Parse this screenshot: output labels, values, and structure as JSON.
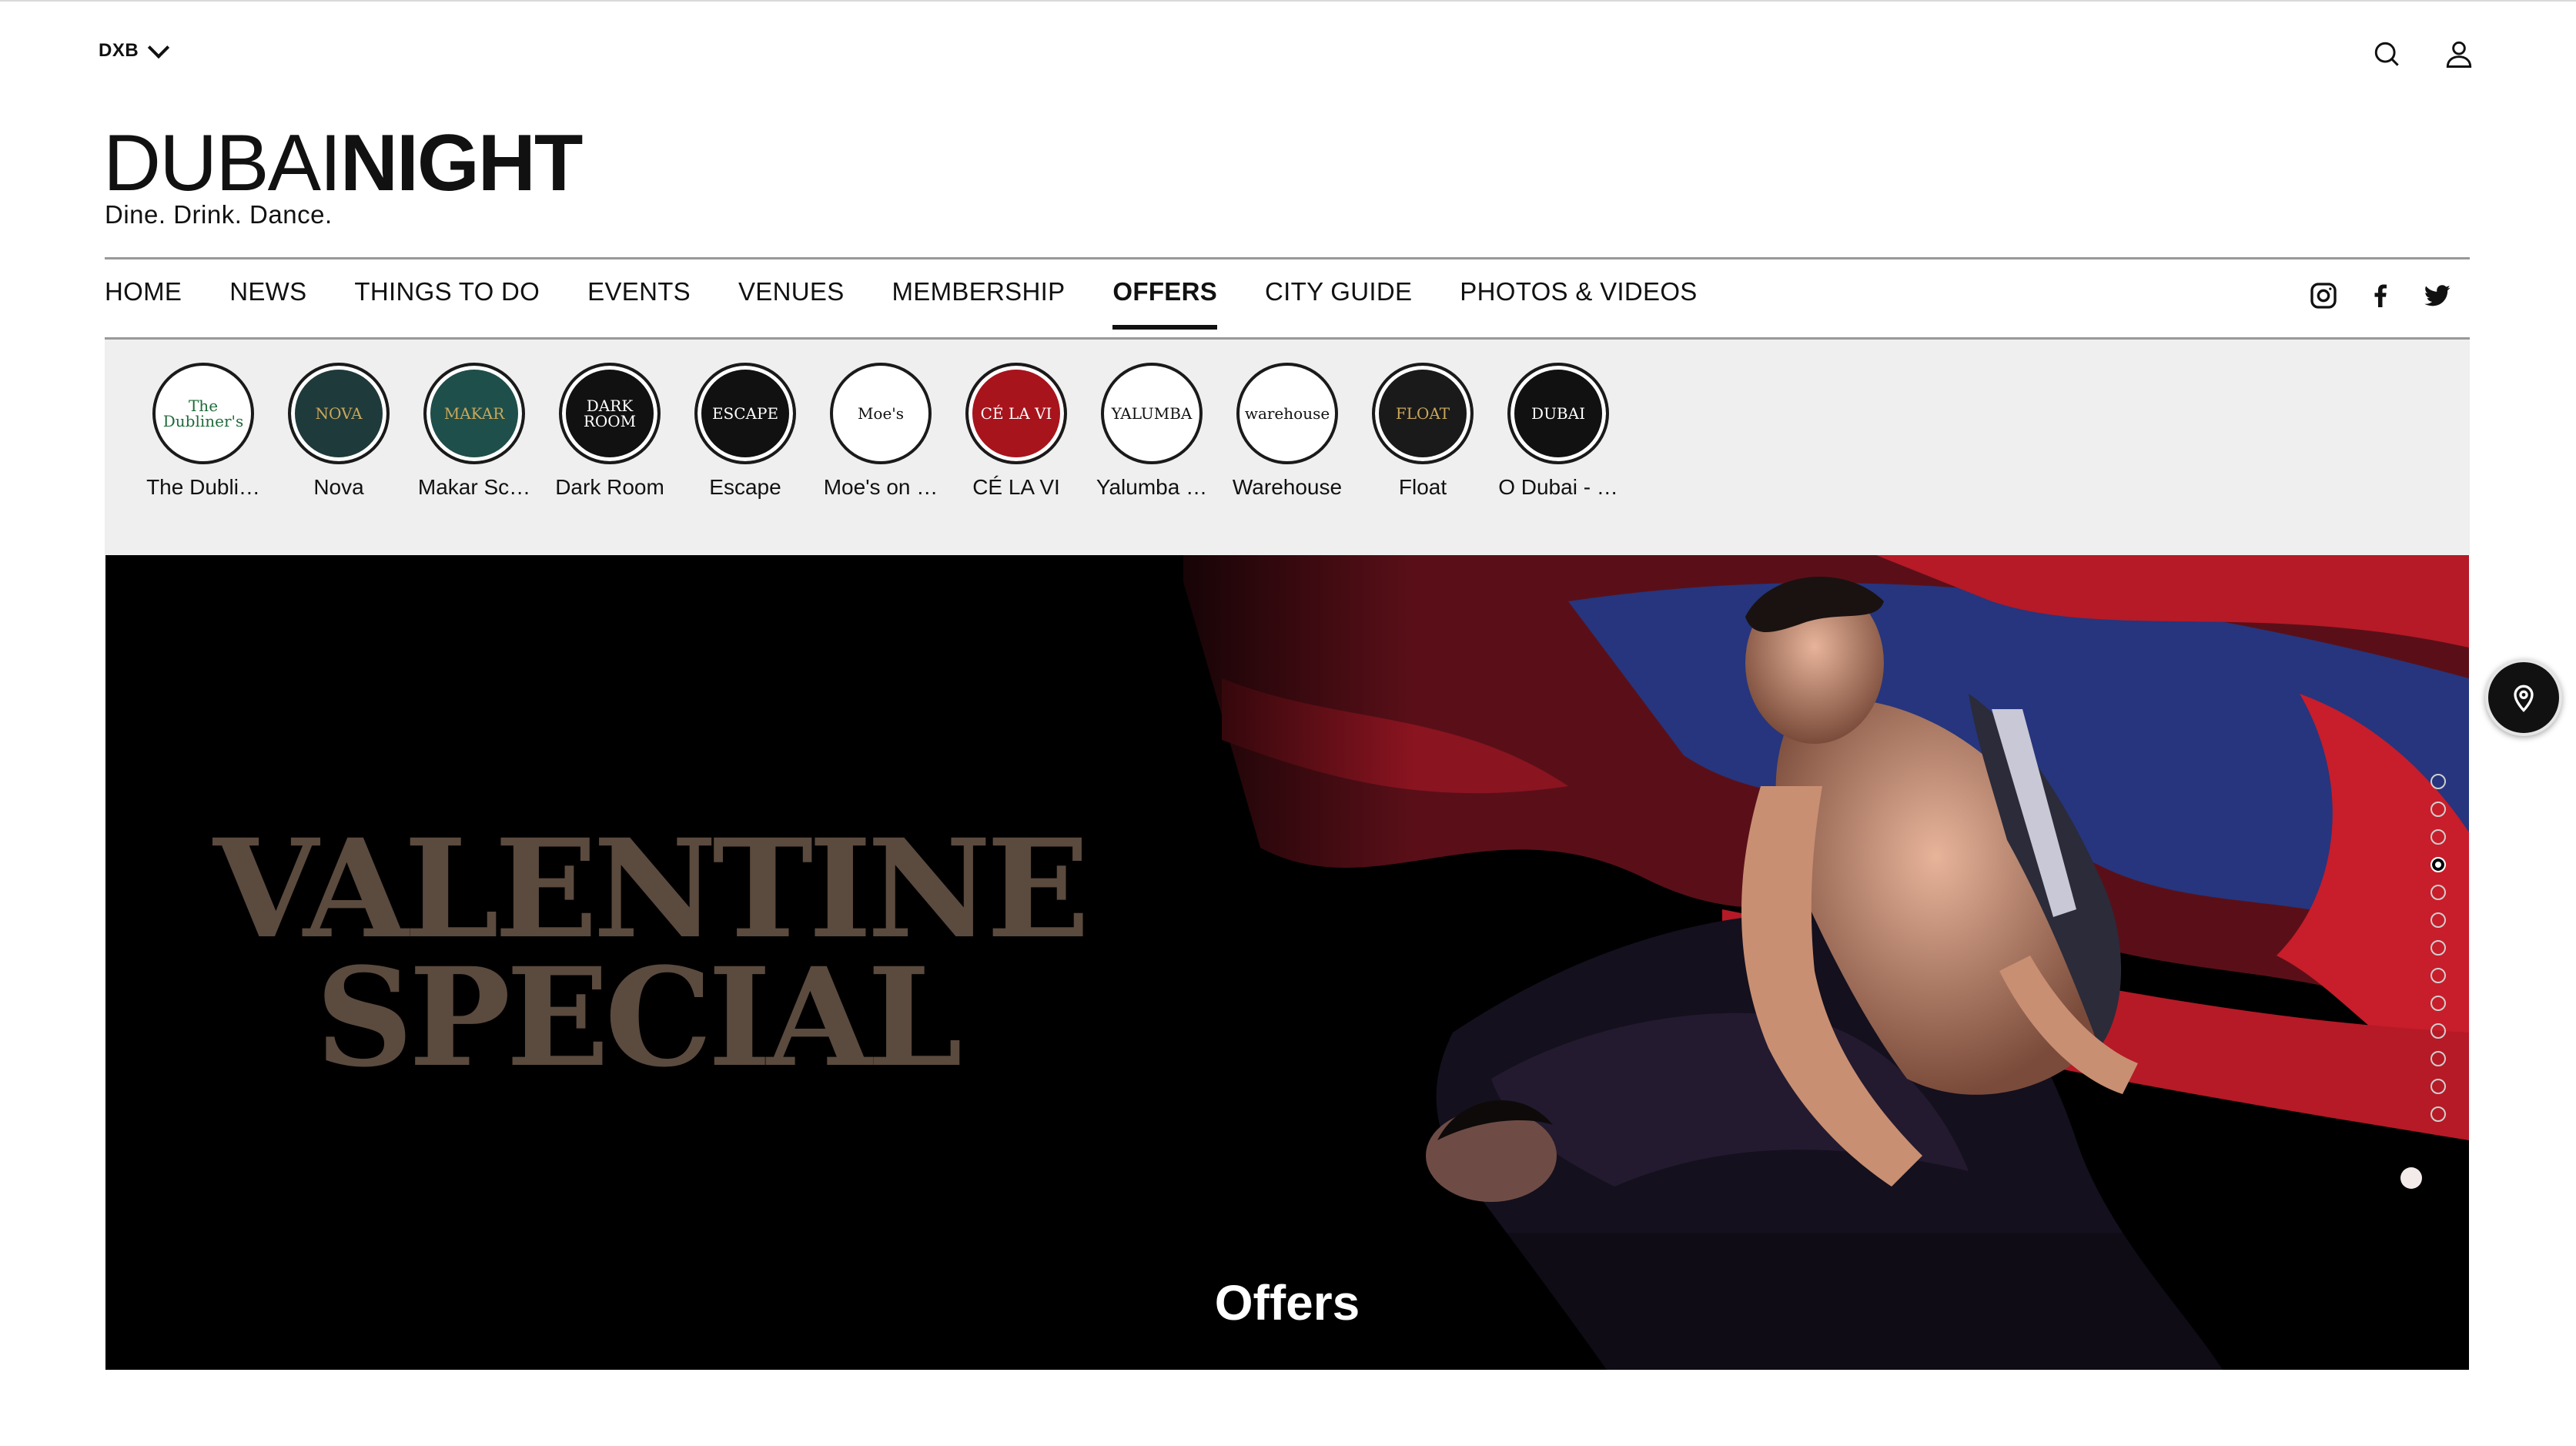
{
  "header": {
    "city": "DXB",
    "logo_light": "DUBAI",
    "logo_bold": "NIGHT",
    "tagline": "Dine. Drink. Dance."
  },
  "nav": {
    "items": [
      {
        "label": "HOME"
      },
      {
        "label": "NEWS"
      },
      {
        "label": "THINGS TO DO"
      },
      {
        "label": "EVENTS"
      },
      {
        "label": "VENUES"
      },
      {
        "label": "MEMBERSHIP"
      },
      {
        "label": "OFFERS",
        "active": true
      },
      {
        "label": "CITY GUIDE"
      },
      {
        "label": "PHOTOS & VIDEOS"
      }
    ],
    "social": [
      "instagram-icon",
      "facebook-icon",
      "twitter-icon"
    ]
  },
  "venues": [
    {
      "name": "The Dubli…",
      "logo": "The Dubliner's",
      "bg": "#ffffff",
      "fg": "#1f6b3a"
    },
    {
      "name": "Nova",
      "logo": "NOVA",
      "bg": "#1f3a3a",
      "fg": "#c9a65a"
    },
    {
      "name": "Makar Sc…",
      "logo": "MAKAR",
      "bg": "#1f4f4a",
      "fg": "#c9a65a"
    },
    {
      "name": "Dark Room",
      "logo": "DARK ROOM",
      "bg": "#111111",
      "fg": "#ffffff"
    },
    {
      "name": "Escape",
      "logo": "ESCAPE",
      "bg": "#111111",
      "fg": "#ffffff"
    },
    {
      "name": "Moe's on …",
      "logo": "Moe's",
      "bg": "#ffffff",
      "fg": "#111111"
    },
    {
      "name": "CÉ LA VI",
      "logo": "CÉ LA VI",
      "bg": "#a8141c",
      "fg": "#ffffff"
    },
    {
      "name": "Yalumba …",
      "logo": "YALUMBA",
      "bg": "#ffffff",
      "fg": "#111111"
    },
    {
      "name": "Warehouse",
      "logo": "warehouse",
      "bg": "#ffffff",
      "fg": "#111111"
    },
    {
      "name": "Float",
      "logo": "FLOAT",
      "bg": "#1a1a1a",
      "fg": "#c9a65a"
    },
    {
      "name": "O Dubai - …",
      "logo": "DUBAI",
      "bg": "#111111",
      "fg": "#ffffff"
    }
  ],
  "hero": {
    "title_line1": "VALENTINE",
    "title_line2": "SPECIAL",
    "caption": "Offers",
    "slide_count": 13,
    "active_slide": 4
  },
  "colors": {
    "accent": "#111111",
    "strip_bg": "#efefef",
    "hero_bg": "#000000"
  }
}
